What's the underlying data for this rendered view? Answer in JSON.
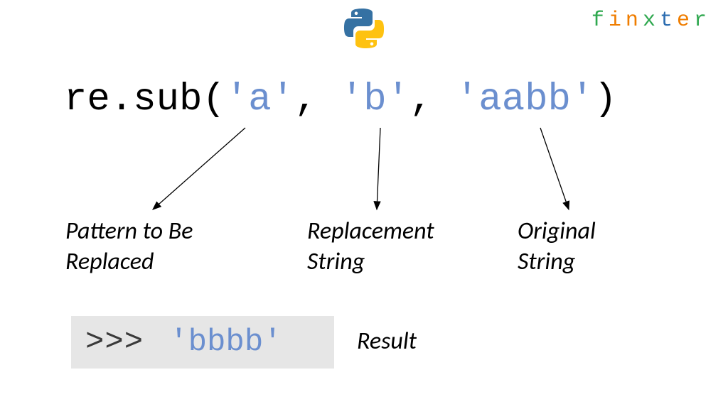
{
  "brand": {
    "letters": [
      "f",
      "i",
      "n",
      "x",
      "t",
      "e",
      "r"
    ],
    "colors": [
      "#2fa84f",
      "#ef7d00",
      "#ef7d00",
      "#2fa84f",
      "#2b6cb0",
      "#ef7d00",
      "#2fa84f"
    ]
  },
  "code": {
    "fn_module": "re",
    "fn_dot": ".",
    "fn_name": "sub",
    "open": "(",
    "arg1": "'a'",
    "sep1": ", ",
    "arg2": "'b'",
    "sep2": ", ",
    "arg3": "'aabb'",
    "close": ")"
  },
  "annotations": {
    "pattern_l1": "Pattern to Be",
    "pattern_l2": "Replaced",
    "replacement_l1": "Replacement",
    "replacement_l2": "String",
    "original_l1": "Original",
    "original_l2": "String"
  },
  "result": {
    "prompt": ">>>",
    "value": "'bbbb'",
    "label": "Result"
  },
  "icons": {
    "python": "python-logo-icon"
  }
}
